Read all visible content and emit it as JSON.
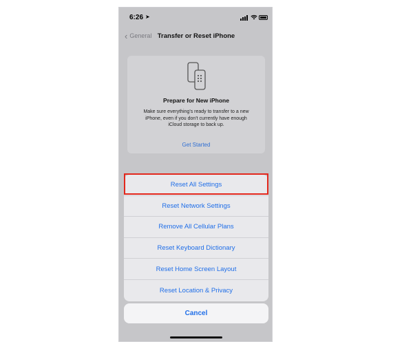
{
  "status_bar": {
    "time": "6:26"
  },
  "nav": {
    "back_label": "General",
    "title": "Transfer or Reset iPhone"
  },
  "card": {
    "icon": "phone-transfer-icon",
    "title": "Prepare for New iPhone",
    "body": "Make sure everything's ready to transfer to a new iPhone, even if you don't currently have enough iCloud storage to back up.",
    "link": "Get Started"
  },
  "action_sheet": {
    "items": [
      {
        "label": "Reset All Settings"
      },
      {
        "label": "Reset Network Settings"
      },
      {
        "label": "Remove All Cellular Plans"
      },
      {
        "label": "Reset Keyboard Dictionary"
      },
      {
        "label": "Reset Home Screen Layout"
      },
      {
        "label": "Reset Location & Privacy"
      }
    ],
    "cancel_label": "Cancel"
  },
  "colors": {
    "accent": "#1f6ee8",
    "highlight": "#e3271c",
    "background": "#c6c6c9"
  }
}
